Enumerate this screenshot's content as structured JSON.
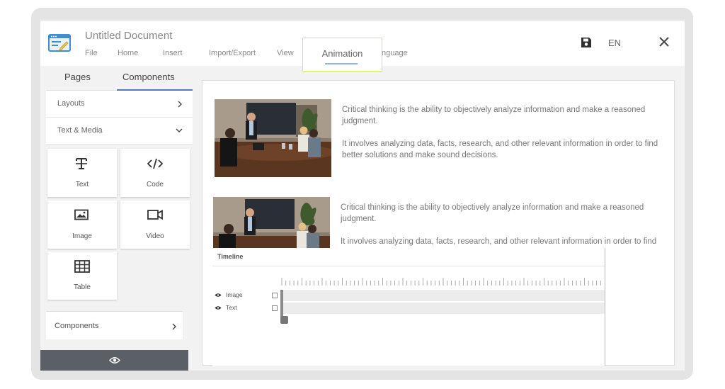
{
  "header": {
    "title": "Untitled Document",
    "menu": [
      "File",
      "Home",
      "Insert",
      "Import/Export",
      "View",
      "Animation",
      "Language"
    ],
    "menu_hidden_part": "nguage",
    "active_menu": "Animation",
    "language": "EN"
  },
  "left_panel": {
    "tabs": [
      "Pages",
      "Components"
    ],
    "active_tab": "Components",
    "sections": {
      "layouts": "Layouts",
      "text_media": "Text & Media",
      "components": "Components"
    },
    "tiles": [
      "Text",
      "Code",
      "Image",
      "Video",
      "Table"
    ]
  },
  "canvas": {
    "block1": {
      "p1": "Critical thinking is the ability to objectively analyze information and make a reasoned judgment.",
      "p2": "It involves analyzing data, facts, research, and other relevant information in order to find better solutions and make sound decisions."
    },
    "block2": {
      "p1": "Critical thinking is the ability to objectively analyze information and make a reasoned judgment.",
      "p2": "It involves analyzing data, facts, research, and other relevant information in order to find"
    }
  },
  "timeline": {
    "title": "Timeline",
    "ticks": [
      "0",
      "5",
      "10",
      "15",
      "20",
      "25",
      "30",
      "35",
      "40",
      "45",
      "50",
      "55",
      "60",
      "65",
      "70",
      "75"
    ],
    "tracks": [
      "Image",
      "Text"
    ]
  },
  "colors": {
    "accent": "#5578b7",
    "highlight_border": "#d7e66a",
    "preview_bar": "#5b5f66"
  }
}
